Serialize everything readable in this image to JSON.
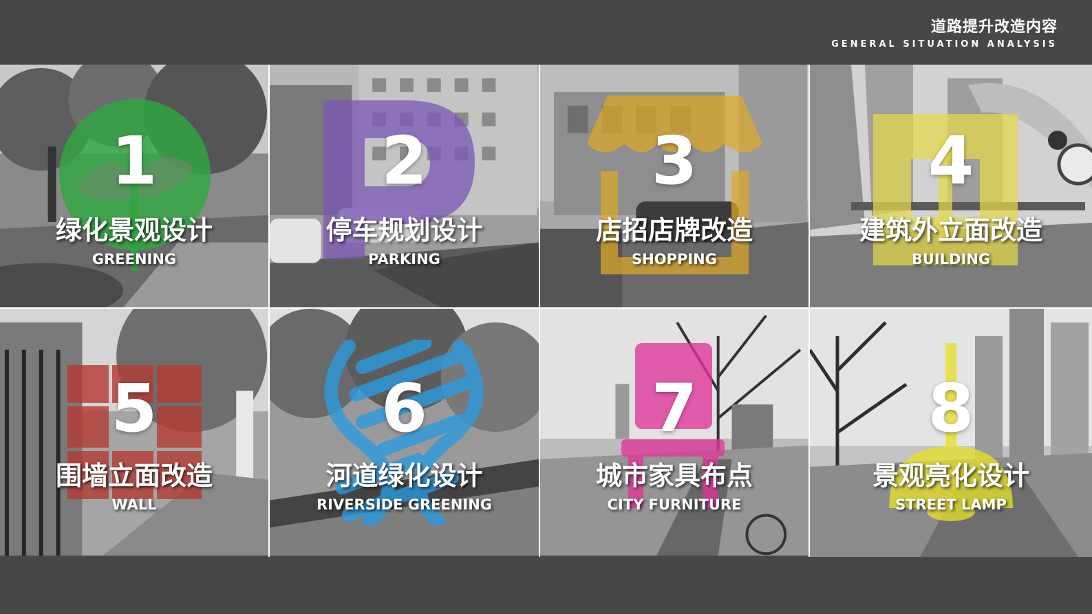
{
  "header": {
    "title_zh": "道路提升改造内容",
    "title_en": "GENERAL SITUATION ANALYSIS"
  },
  "tiles": [
    {
      "number": "1",
      "title_zh": "绿化景观设计",
      "title_en": "GREENING",
      "icon": "leaf-icon",
      "accent": "#2fa641"
    },
    {
      "number": "2",
      "title_zh": "停车规划设计",
      "title_en": "PARKING",
      "icon": "parking-p-icon",
      "accent": "#7b55b5"
    },
    {
      "number": "3",
      "title_zh": "店招店牌改造",
      "title_en": "SHOPPING",
      "icon": "shop-icon",
      "accent": "#e0a92a"
    },
    {
      "number": "4",
      "title_zh": "建筑外立面改造",
      "title_en": "BUILDING",
      "icon": "building-icon",
      "accent": "#e4d84a"
    },
    {
      "number": "5",
      "title_zh": "围墙立面改造",
      "title_en": "WALL",
      "icon": "brick-wall-icon",
      "accent": "#b53a33"
    },
    {
      "number": "6",
      "title_zh": "河道绿化设计",
      "title_en": "RIVERSIDE GREENING",
      "icon": "river-wave-icon",
      "accent": "#2b9be0"
    },
    {
      "number": "7",
      "title_zh": "城市家具布点",
      "title_en": "CITY FURNITURE",
      "icon": "chair-icon",
      "accent": "#e0359b"
    },
    {
      "number": "8",
      "title_zh": "景观亮化设计",
      "title_en": "STREET LAMP",
      "icon": "lamp-icon",
      "accent": "#e6e02c"
    }
  ]
}
